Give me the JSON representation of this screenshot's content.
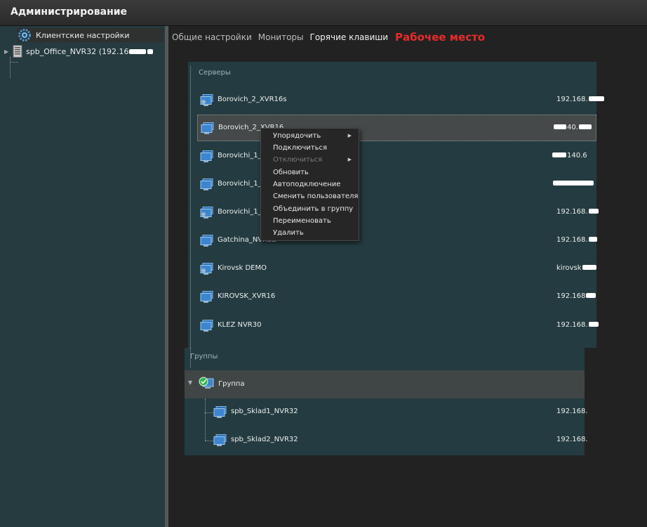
{
  "window": {
    "title": "Администрирование"
  },
  "tree": {
    "items": [
      {
        "label": "Клиентские настройки"
      },
      {
        "label": "spb_Office_NVR32 (192.16"
      }
    ]
  },
  "tabs": [
    {
      "label": "Общие настройки"
    },
    {
      "label": "Мониторы"
    },
    {
      "label": "Горячие клавиши"
    },
    {
      "label": "Рабочее место"
    }
  ],
  "servers": {
    "section_label": "Серверы",
    "rows": [
      {
        "name": "Borovich_2_XVR16s",
        "ip": "192.168."
      },
      {
        "name": "Borovich_2_XVR16",
        "ip": "40."
      },
      {
        "name": "Borovichi_1_X",
        "ip": "140.6"
      },
      {
        "name": "Borovichi_1_X",
        "ip": ""
      },
      {
        "name": "Borovichi_1_X",
        "ip": "192.168."
      },
      {
        "name": "Gatchina_NVR32",
        "ip": "192.168."
      },
      {
        "name": "Kirovsk DEMO",
        "ip": "kirovsk"
      },
      {
        "name": "KIROVSK_XVR16",
        "ip": "192.168"
      },
      {
        "name": "KLEZ NVR30",
        "ip": "192.168."
      }
    ]
  },
  "groups": {
    "section_label": "Группы",
    "group_name": "Группа",
    "rows": [
      {
        "name": "spb_Sklad1_NVR32",
        "ip": "192.168."
      },
      {
        "name": "spb_Sklad2_NVR32",
        "ip": "192.168."
      }
    ]
  },
  "context_menu": {
    "items": [
      {
        "label": "Упорядочить",
        "submenu": true,
        "disabled": false
      },
      {
        "label": "Подключиться",
        "submenu": false,
        "disabled": false
      },
      {
        "label": "Отключиться",
        "submenu": true,
        "disabled": true
      },
      {
        "label": "Обновить",
        "submenu": false,
        "disabled": false
      },
      {
        "label": "Автоподключение",
        "submenu": false,
        "disabled": false
      },
      {
        "label": "Сменить пользователя",
        "submenu": false,
        "disabled": false
      },
      {
        "label": "Объединить в группу",
        "submenu": false,
        "disabled": false
      },
      {
        "label": "Переименовать",
        "submenu": false,
        "disabled": false
      },
      {
        "label": "Удалить",
        "submenu": false,
        "disabled": false
      }
    ]
  },
  "colors": {
    "accent_tab": "#e82a2a",
    "panel_bg": "#243c41",
    "selected_row": "#45494a"
  }
}
